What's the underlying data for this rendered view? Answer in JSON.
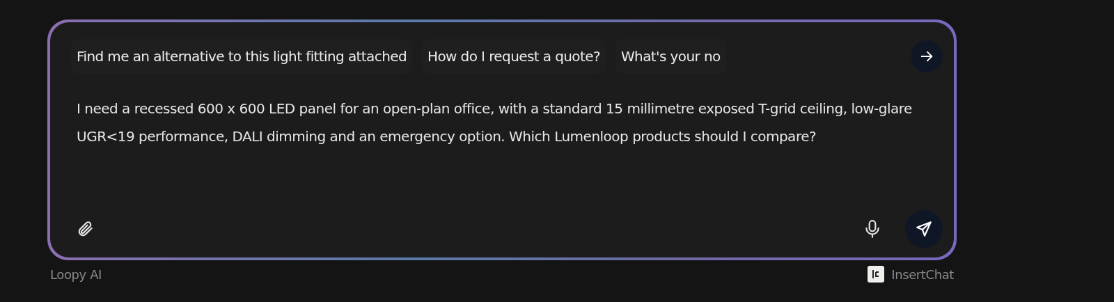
{
  "suggestions": [
    {
      "label": "Find me an alternative to this light fitting attached"
    },
    {
      "label": "How do I request a quote?"
    },
    {
      "label": "What's your no"
    }
  ],
  "message": {
    "value": "I need a recessed 600 x 600 LED panel for an open-plan office, with a standard 15 millimetre exposed T-grid ceiling, low-glare UGR<19 performance, DALI dimming and an emergency option. Which Lumenloop products should I compare?"
  },
  "footer": {
    "left": "Loopy AI",
    "right": "InsertChat"
  }
}
